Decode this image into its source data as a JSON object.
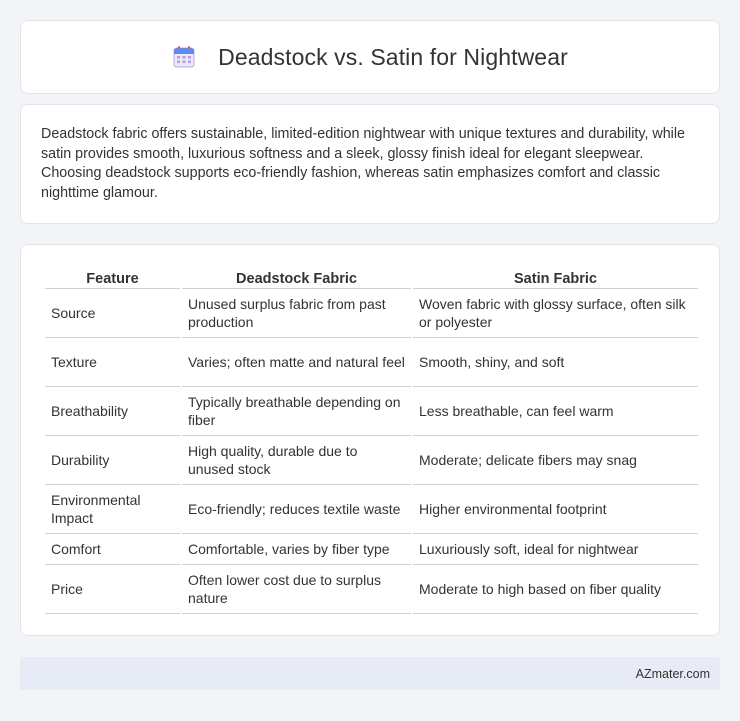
{
  "header": {
    "title": "Deadstock vs. Satin for Nightwear",
    "icon": "calendar-icon"
  },
  "intro": {
    "text": "Deadstock fabric offers sustainable, limited-edition nightwear with unique textures and durability, while satin provides smooth, luxurious softness and a sleek, glossy finish ideal for elegant sleepwear. Choosing deadstock supports eco-friendly fashion, whereas satin emphasizes comfort and classic nighttime glamour."
  },
  "table": {
    "headers": [
      "Feature",
      "Deadstock Fabric",
      "Satin Fabric"
    ],
    "rows": [
      [
        "Source",
        "Unused surplus fabric from past production",
        "Woven fabric with glossy surface, often silk or polyester"
      ],
      [
        "Texture",
        "Varies; often matte and natural feel",
        "Smooth, shiny, and soft"
      ],
      [
        "Breathability",
        "Typically breathable depending on fiber",
        "Less breathable, can feel warm"
      ],
      [
        "Durability",
        "High quality, durable due to unused stock",
        "Moderate; delicate fibers may snag"
      ],
      [
        "Environmental Impact",
        "Eco-friendly; reduces textile waste",
        "Higher environmental footprint"
      ],
      [
        "Comfort",
        "Comfortable, varies by fiber type",
        "Luxuriously soft, ideal for nightwear"
      ],
      [
        "Price",
        "Often lower cost due to surplus nature",
        "Moderate to high based on fiber quality"
      ]
    ]
  },
  "footer": {
    "text": "AZmater.com"
  }
}
